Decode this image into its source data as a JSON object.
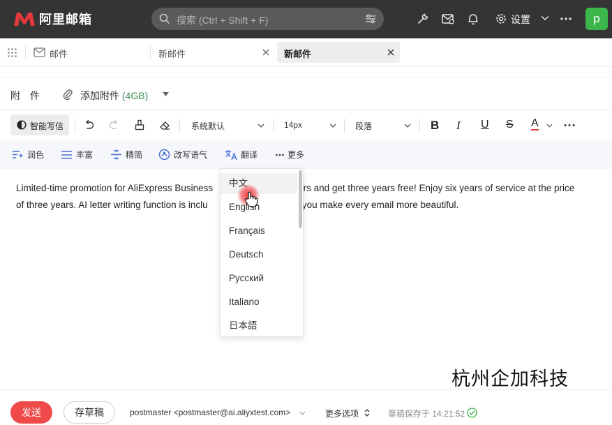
{
  "app": {
    "name": "阿里邮箱",
    "brand_color": "#e4393c"
  },
  "topbar": {
    "search_placeholder": "搜索 (Ctrl + Shift + F)",
    "settings_label": "设置",
    "avatar_letter": "p",
    "icons": [
      "wrench-icon",
      "mail-settings-icon",
      "bell-icon",
      "gear-icon",
      "chevron-down-icon",
      "more-icon"
    ]
  },
  "tabs": [
    {
      "label": "邮件",
      "active": false
    },
    {
      "label": "新邮件",
      "active": false
    },
    {
      "label": "新邮件",
      "active": true
    }
  ],
  "attachment": {
    "label": "附　件",
    "add_label": "添加附件",
    "size": "(4GB)"
  },
  "toolbar": {
    "ai_write": "智能写信",
    "font_family": "系统默认",
    "font_size": "14px",
    "paragraph": "段落"
  },
  "ai_actions": [
    {
      "label": "润色",
      "icon": "polish-icon"
    },
    {
      "label": "丰富",
      "icon": "enrich-icon"
    },
    {
      "label": "精简",
      "icon": "simplify-icon"
    },
    {
      "label": "改写语气",
      "icon": "tone-icon"
    },
    {
      "label": "翻译",
      "icon": "translate-icon"
    },
    {
      "label": "更多",
      "icon": "more-icon"
    }
  ],
  "body": {
    "line1_before": "Limited-time promotion for AliExpress Business",
    "line1_after": "ars and get three years free! Enjoy six years of service at the price",
    "line2_before": "of three years. AI letter writing function is inclu",
    "line2_after": "g you make every email more beautiful."
  },
  "language_dropdown": {
    "hovered_index": 0,
    "items": [
      "中文",
      "English",
      "Français",
      "Deutsch",
      "Русский",
      "Italiano",
      "日本語"
    ]
  },
  "watermark": "杭州企加科技",
  "bottom": {
    "send": "发送",
    "save_draft": "存草稿",
    "sender": "postmaster <postmaster@ai.aliyxtest.com>",
    "more_options": "更多选项",
    "draft_status": "草稿保存于 14:21:52"
  }
}
